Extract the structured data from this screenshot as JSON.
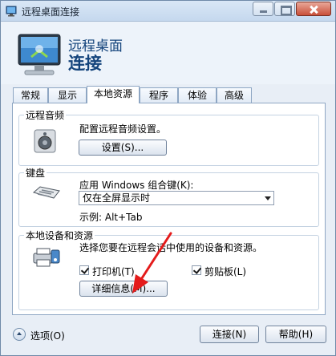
{
  "window": {
    "title": "远程桌面连接"
  },
  "header": {
    "line1": "远程桌面",
    "line2": "连接"
  },
  "tabs": [
    {
      "label": "常规"
    },
    {
      "label": "显示"
    },
    {
      "label": "本地资源"
    },
    {
      "label": "程序"
    },
    {
      "label": "体验"
    },
    {
      "label": "高级"
    }
  ],
  "audio": {
    "title": "远程音频",
    "description": "配置远程音频设置。",
    "settings_button": "设置(S)..."
  },
  "keyboard": {
    "title": "键盘",
    "label": "应用 Windows 组合键(K):",
    "selected": "仅在全屏显示时",
    "example": "示例: Alt+Tab"
  },
  "devices": {
    "title": "本地设备和资源",
    "description": "选择您要在远程会话中使用的设备和资源。",
    "printer_label": "打印机(T)",
    "printer_checked": true,
    "clipboard_label": "剪贴板(L)",
    "clipboard_checked": true,
    "details_button": "详细信息(M)..."
  },
  "footer": {
    "options_label": "选项(O)",
    "connect_button": "连接(N)",
    "help_button": "帮助(H)"
  },
  "colors": {
    "accent": "#14447c",
    "annotation_arrow": "#e41b1b"
  }
}
